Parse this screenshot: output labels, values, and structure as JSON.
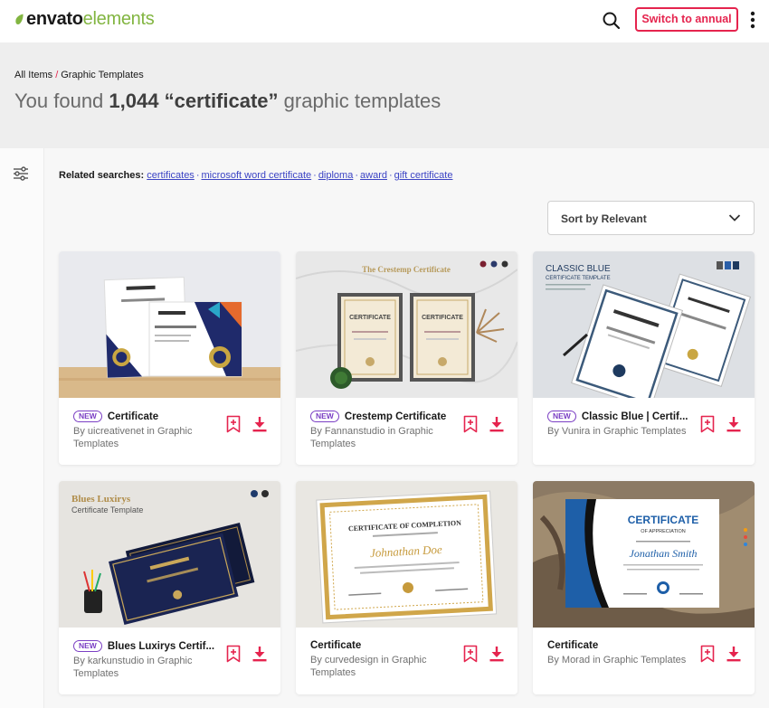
{
  "header": {
    "logo_brand": "envato",
    "logo_suffix": "elements",
    "cta_label": "Switch to annual",
    "icons": {
      "search": "search-icon",
      "more": "more-vertical-icon",
      "logo": "leaf-icon"
    },
    "colors": {
      "accent": "#e5244e",
      "brand_green": "#82b541"
    }
  },
  "breadcrumb": {
    "root": "All Items",
    "separator": "/",
    "current": "Graphic Templates"
  },
  "results": {
    "prefix": "You found ",
    "count": "1,044",
    "query": " “certificate”",
    "suffix": " graphic templates"
  },
  "sidebar": {
    "filter_icon": "sliders-icon"
  },
  "related": {
    "label": "Related searches:",
    "links": [
      "certificates",
      "microsoft word certificate",
      "diploma",
      "award",
      "gift certificate"
    ]
  },
  "sort": {
    "label": "Sort by Relevant"
  },
  "cards": [
    {
      "badge": "NEW",
      "title": "Certificate",
      "by_prefix": "By ",
      "author": "uicreativenet",
      "in_text": " in ",
      "category": "Graphic Templates"
    },
    {
      "badge": "NEW",
      "title": "Crestemp Certificate",
      "by_prefix": "By ",
      "author": "Fannanstudio",
      "in_text": " in ",
      "category": "Graphic Templates",
      "thumb_heading": "The Crestemp Certificate",
      "thumb_label": "CERTIFICATE"
    },
    {
      "badge": "NEW",
      "title": "Classic Blue | Certif...",
      "by_prefix": "By ",
      "author": "Vunira",
      "in_text": " in ",
      "category": "Graphic Templates",
      "thumb_heading": "CLASSIC BLUE",
      "thumb_sub": "CERTIFICATE TEMPLATE"
    },
    {
      "badge": "NEW",
      "title": "Blues Luxirys Certif...",
      "by_prefix": "By ",
      "author": "karkunstudio",
      "in_text": " in ",
      "category": "Graphic Templates",
      "thumb_heading": "Blues Luxirys",
      "thumb_sub": "Certificate Template"
    },
    {
      "badge": "",
      "title": "Certificate",
      "by_prefix": "By ",
      "author": "curvedesign",
      "in_text": " in ",
      "category": "Graphic Templates",
      "thumb_heading": "CERTIFICATE OF COMPLETION",
      "thumb_name": "Johnathan Doe"
    },
    {
      "badge": "",
      "title": "Certificate",
      "by_prefix": "By ",
      "author": "Morad",
      "in_text": " in ",
      "category": "Graphic Templates",
      "thumb_heading": "CERTIFICATE",
      "thumb_sub": "OF APPRECIATION",
      "thumb_name": "Jonathan Smith"
    }
  ]
}
